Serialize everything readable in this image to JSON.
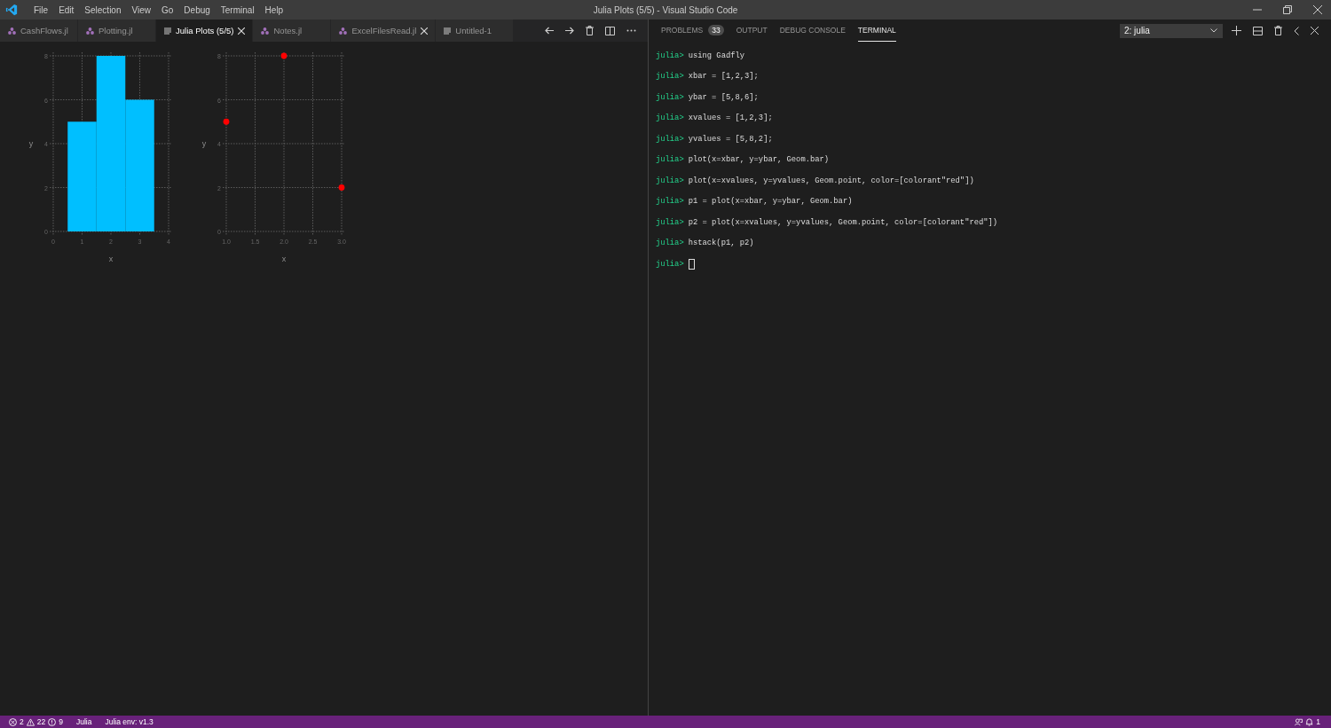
{
  "window": {
    "title": "Julia Plots (5/5) - Visual Studio Code"
  },
  "menu": [
    "File",
    "Edit",
    "Selection",
    "View",
    "Go",
    "Debug",
    "Terminal",
    "Help"
  ],
  "editor_tabs": [
    {
      "label": "CashFlows.jl",
      "kind": "julia",
      "selected": false,
      "close_visible": false
    },
    {
      "label": "Plotting.jl",
      "kind": "julia",
      "selected": false,
      "close_visible": false
    },
    {
      "label": "Julia Plots (5/5)",
      "kind": "preview",
      "selected": true,
      "close_visible": true
    },
    {
      "label": "Notes.jl",
      "kind": "julia",
      "selected": false,
      "close_visible": false
    },
    {
      "label": "ExcelFilesRead.jl",
      "kind": "julia",
      "selected": false,
      "close_visible": true
    },
    {
      "label": "Untitled-1",
      "kind": "preview",
      "selected": false,
      "close_visible": false
    }
  ],
  "plots": [
    {
      "chart_data": {
        "type": "bar",
        "xlabel": "x",
        "ylabel": "y",
        "grid": true,
        "x": [
          1,
          2,
          3
        ],
        "series": [
          {
            "color": "#00bfff",
            "values": [
              5,
              8,
              6
            ]
          }
        ],
        "xlim": [
          0,
          4
        ],
        "ylim": [
          0,
          8
        ],
        "xticks": [
          0,
          1,
          2,
          3,
          4
        ],
        "yticks": [
          0,
          2,
          4,
          6,
          8
        ]
      }
    },
    {
      "chart_data": {
        "type": "scatter",
        "xlabel": "x",
        "ylabel": "y",
        "grid": true,
        "x": [
          1,
          2,
          3
        ],
        "series": [
          {
            "color": "#ff0000",
            "values": [
              5,
              8,
              2
            ]
          }
        ],
        "xlim": [
          1,
          3
        ],
        "ylim": [
          0,
          8
        ],
        "xticks": [
          {
            "value": 1,
            "label": "1.0"
          },
          {
            "value": 1.5,
            "label": "1.5"
          },
          {
            "value": 2,
            "label": "2.0"
          },
          {
            "value": 2.5,
            "label": "2.5"
          },
          {
            "value": 3,
            "label": "3.0"
          }
        ],
        "yticks": [
          0,
          2,
          4,
          6,
          8
        ]
      }
    }
  ],
  "panel": {
    "tabs": [
      {
        "label": "PROBLEMS",
        "badge": "33",
        "selected": false
      },
      {
        "label": "OUTPUT",
        "selected": false
      },
      {
        "label": "DEBUG CONSOLE",
        "selected": false
      },
      {
        "label": "TERMINAL",
        "selected": true
      }
    ],
    "terminal_select": "2: julia",
    "terminal_lines": [
      {
        "prompt": "julia>",
        "command": "using Gadfly"
      },
      {
        "prompt": "julia>",
        "command": "xbar = [1,2,3];"
      },
      {
        "prompt": "julia>",
        "command": "ybar = [5,8,6];"
      },
      {
        "prompt": "julia>",
        "command": "xvalues = [1,2,3];"
      },
      {
        "prompt": "julia>",
        "command": "yvalues = [5,8,2];"
      },
      {
        "prompt": "julia>",
        "command": "plot(x=xbar, y=ybar, Geom.bar)"
      },
      {
        "prompt": "julia>",
        "command": "plot(x=xvalues, y=yvalues, Geom.point, color=[colorant\"red\"])"
      },
      {
        "prompt": "julia>",
        "command": "p1 = plot(x=xbar, y=ybar, Geom.bar)"
      },
      {
        "prompt": "julia>",
        "command": "p2 = plot(x=xvalues, y=yvalues, Geom.point, color=[colorant\"red\"])"
      },
      {
        "prompt": "julia>",
        "command": "hstack(p1, p2)"
      },
      {
        "prompt": "julia>",
        "cursor": true
      }
    ]
  },
  "status_bar": {
    "errors": "2",
    "warnings": "22",
    "infos": "9",
    "items": [
      "Julia",
      "Julia env: v1.3"
    ],
    "notifications": "1"
  }
}
